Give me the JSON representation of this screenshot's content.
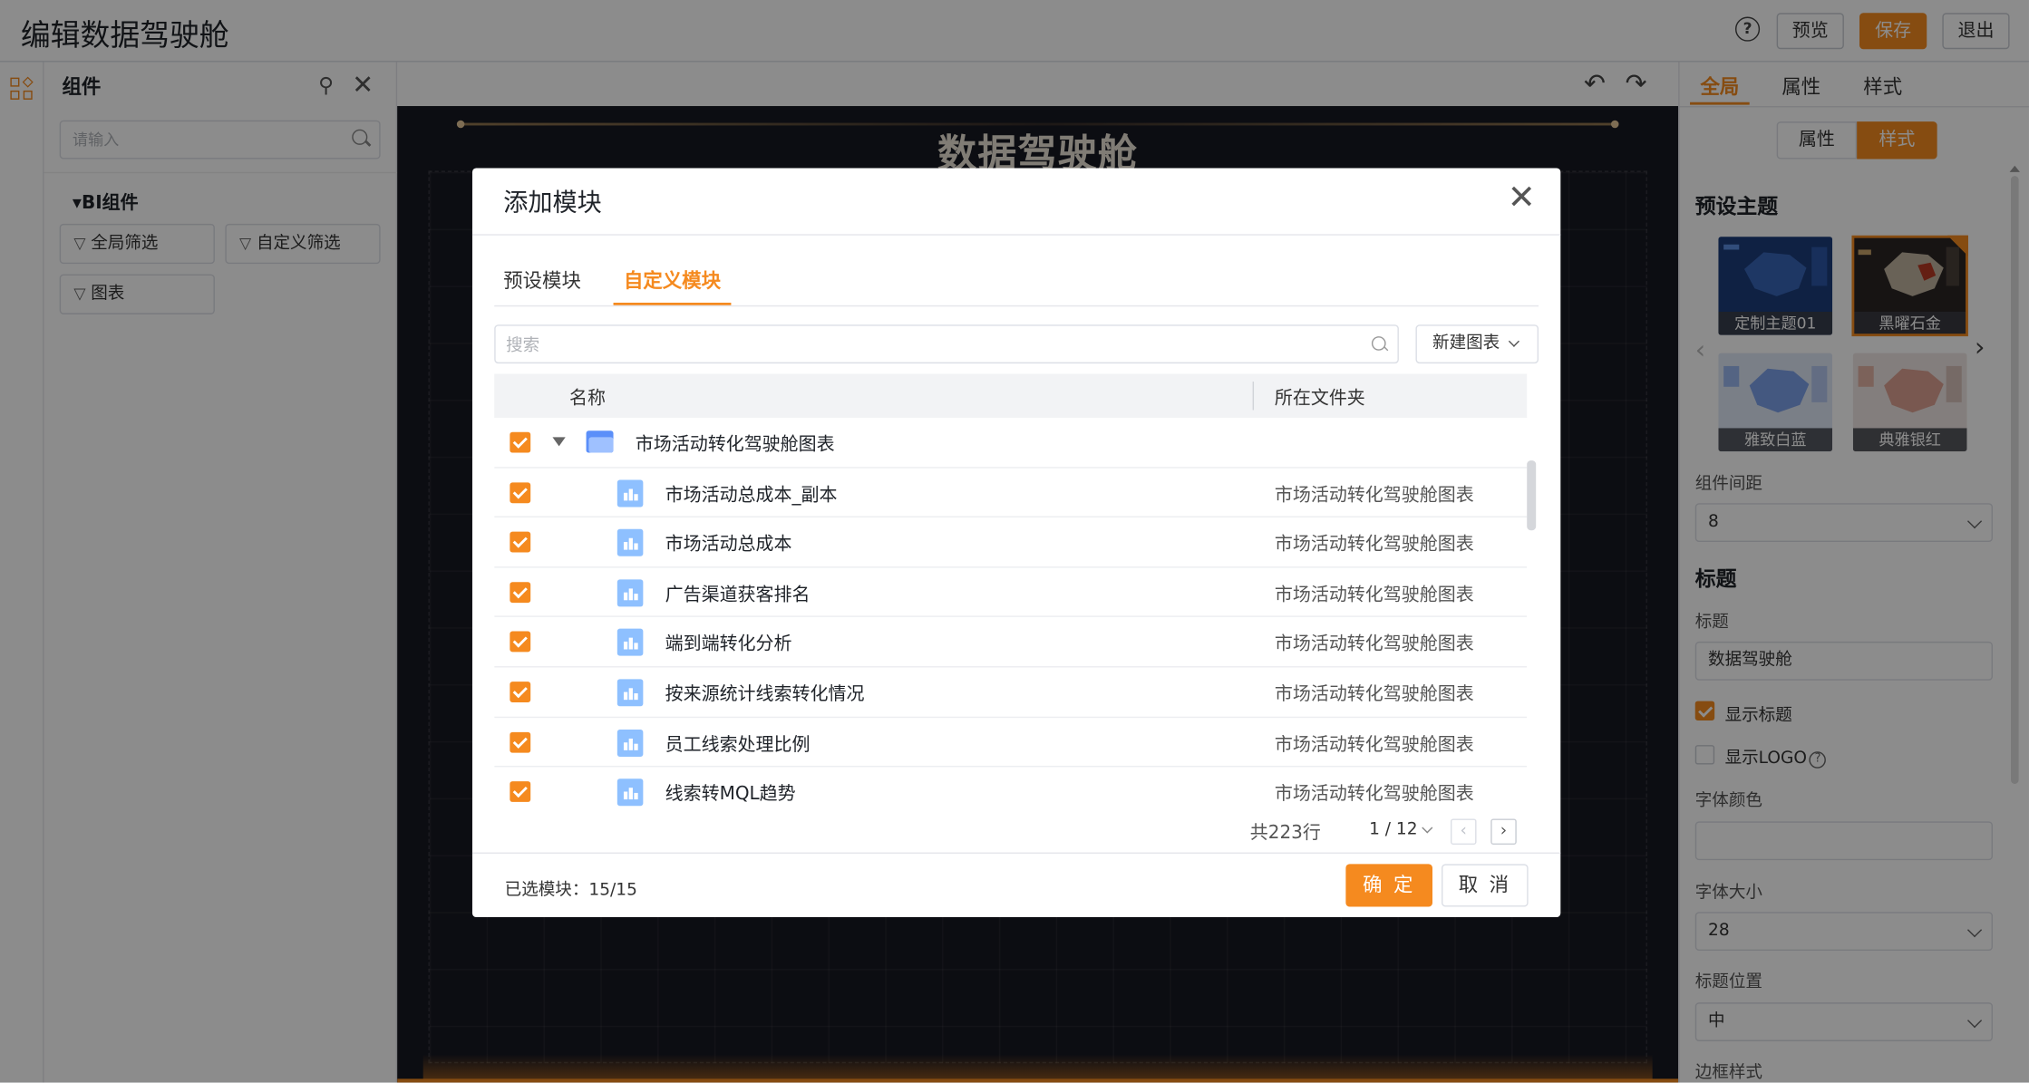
{
  "app": {
    "title": "编辑数据驾驶舱"
  },
  "topbar": {
    "preview_label": "预览",
    "save_label": "保存",
    "exit_label": "退出",
    "help_icon": "?"
  },
  "component_panel": {
    "title": "组件",
    "search_placeholder": "请输入",
    "group_label": "BI组件",
    "items": [
      {
        "label": "全局筛选"
      },
      {
        "label": "自定义筛选"
      },
      {
        "label": "图表"
      }
    ]
  },
  "canvas": {
    "title": "数据驾驶舱"
  },
  "right_panel": {
    "tabs": [
      {
        "label": "全局"
      },
      {
        "label": "属性"
      },
      {
        "label": "样式"
      }
    ],
    "segment": {
      "attr_label": "属性",
      "style_label": "样式"
    },
    "preset_theme_heading": "预设主题",
    "themes": [
      {
        "label": "定制主题01",
        "color": "#1d3d7a"
      },
      {
        "label": "黑曜石金",
        "color": "#2a2624"
      },
      {
        "label": "雅致白蓝",
        "color": "#dfe8f6"
      },
      {
        "label": "典雅银红",
        "color": "#efe6e3"
      }
    ],
    "spacing_label": "组件间距",
    "spacing_value": "8",
    "title_heading": "标题",
    "title_label": "标题",
    "title_value": "数据驾驶舱",
    "show_title_label": "显示标题",
    "show_logo_label": "显示LOGO",
    "font_color_label": "字体颜色",
    "font_size_label": "字体大小",
    "font_size_value": "28",
    "title_position_label": "标题位置",
    "title_position_value": "中",
    "border_style_label": "边框样式"
  },
  "modal": {
    "title": "添加模块",
    "tabs": [
      {
        "label": "预设模块"
      },
      {
        "label": "自定义模块"
      }
    ],
    "search_placeholder": "搜索",
    "new_chart_label": "新建图表",
    "columns": {
      "name": "名称",
      "folder": "所在文件夹"
    },
    "folder_row": {
      "name": "市场活动转化驾驶舱图表"
    },
    "rows": [
      {
        "name": "市场活动总成本_副本",
        "folder": "市场活动转化驾驶舱图表"
      },
      {
        "name": "市场活动总成本",
        "folder": "市场活动转化驾驶舱图表"
      },
      {
        "name": "广告渠道获客排名",
        "folder": "市场活动转化驾驶舱图表"
      },
      {
        "name": "端到端转化分析",
        "folder": "市场活动转化驾驶舱图表"
      },
      {
        "name": "按来源统计线索转化情况",
        "folder": "市场活动转化驾驶舱图表"
      },
      {
        "name": "员工线索处理比例",
        "folder": "市场活动转化驾驶舱图表"
      },
      {
        "name": "线索转MQL趋势",
        "folder": "市场活动转化驾驶舱图表"
      }
    ],
    "pager": {
      "total": "共223行",
      "page": "1 / 12",
      "prev": "‹",
      "next": "›"
    },
    "selected_label": "已选模块：15/15",
    "ok_label": "确 定",
    "cancel_label": "取 消"
  },
  "colors": {
    "accent": "#f58a1f",
    "chart_icon": "#8ec0ff",
    "folder_icon": "#5b8ff9"
  }
}
